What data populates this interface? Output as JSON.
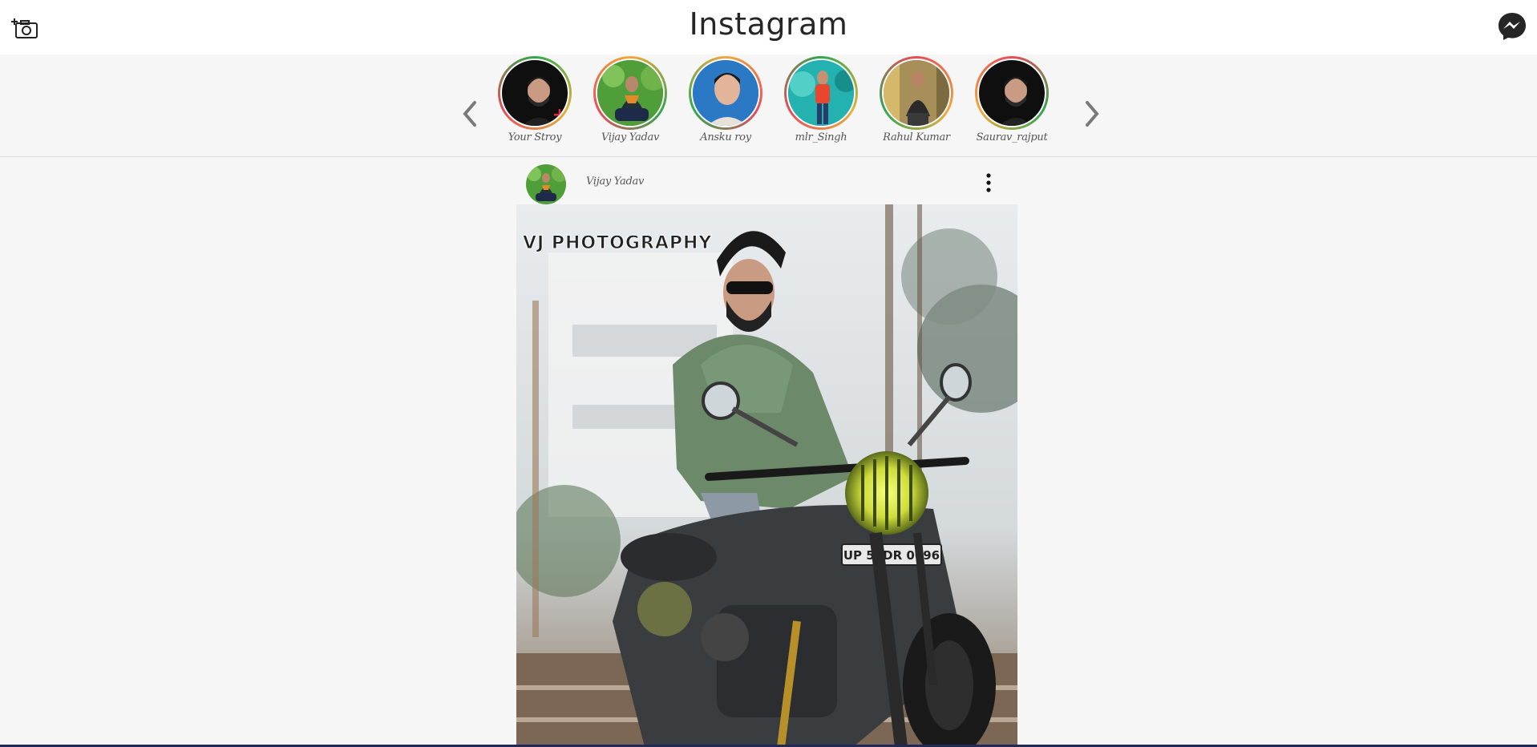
{
  "header": {
    "brand": "Instagram",
    "camera_icon": "add-photo-camera-icon",
    "messenger_icon": "messenger-icon"
  },
  "stories": {
    "prev_icon": "chevron-left-icon",
    "next_icon": "chevron-right-icon",
    "items": [
      {
        "label": "Your Stroy",
        "ring": "#2fa84f"
      },
      {
        "label": "Vijay Yadav",
        "ring": "#f0a93b"
      },
      {
        "label": "Ansku roy",
        "ring": "#f0a93b"
      },
      {
        "label": "mlr_Singh",
        "ring": "#2fa84f"
      },
      {
        "label": "Rahul Kumar",
        "ring": "#e74c5c"
      },
      {
        "label": "Saurav_rajput",
        "ring": "#e74c5c"
      }
    ]
  },
  "post": {
    "username": "Vijay Yadav",
    "menu_icon": "more-vertical-icon",
    "watermark": "VJ PHOTOGRAPHY",
    "plate": "UP 53DR 0696"
  },
  "colors": {
    "accent_red": "#e3263f",
    "text_dark": "#262626",
    "background": "#f6f6f6"
  }
}
